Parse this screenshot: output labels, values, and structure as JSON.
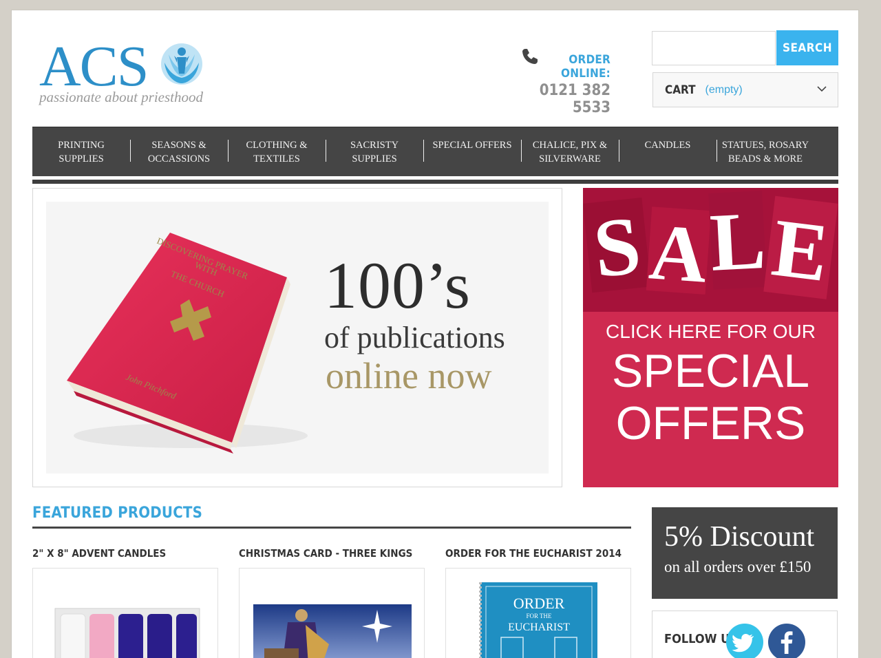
{
  "brand": {
    "logo_text": "ACS",
    "tagline": "passionate about priesthood",
    "colors": {
      "accent": "#3ab3ee",
      "dark": "#454545",
      "sale": "#cf2a50",
      "gold": "#a89766"
    }
  },
  "header": {
    "order_label": "ORDER ONLINE:",
    "phone": "0121 382 5533",
    "search": {
      "placeholder": "",
      "button_label": "SEARCH"
    },
    "cart": {
      "label": "CART",
      "status": "(empty)"
    }
  },
  "nav": {
    "items": [
      "PRINTING\nSUPPLIES",
      "SEASONS &\nOCCASSIONS",
      "CLOTHING &\nTEXTILES",
      "SACRISTY\nSUPPLIES",
      "SPECIAL OFFERS",
      "CHALICE, PIX &\nSILVERWARE",
      "CANDLES",
      "STATUES, ROSARY\nBEADS & MORE"
    ]
  },
  "banner": {
    "big": "100’s",
    "mid": "of publications",
    "low": "online now",
    "book_title": "DISCOVERING PRAYER WITH THE CHURCH",
    "book_author": "John Pitchford"
  },
  "sale": {
    "letters": [
      "S",
      "A",
      "L",
      "E"
    ],
    "click_text": "CLICK HERE FOR OUR",
    "special": "SPECIAL",
    "offers": "OFFERS"
  },
  "featured": {
    "title": "FEATURED PRODUCTS",
    "products": [
      {
        "name": "2\" X 8\" ADVENT CANDLES"
      },
      {
        "name": "CHRISTMAS CARD - THREE KINGS"
      },
      {
        "name": "ORDER FOR THE EUCHARIST 2014"
      }
    ],
    "eucharist_cover": {
      "line1": "ORDER",
      "line2": "FOR THE",
      "line3": "EUCHARIST"
    }
  },
  "sidebar": {
    "discount_big": "5% Discount",
    "discount_small": "on all orders over £150",
    "follow_label": "FOLLOW US:",
    "twitter_icon": "twitter-bird-icon",
    "facebook_icon": "facebook-f-icon"
  }
}
